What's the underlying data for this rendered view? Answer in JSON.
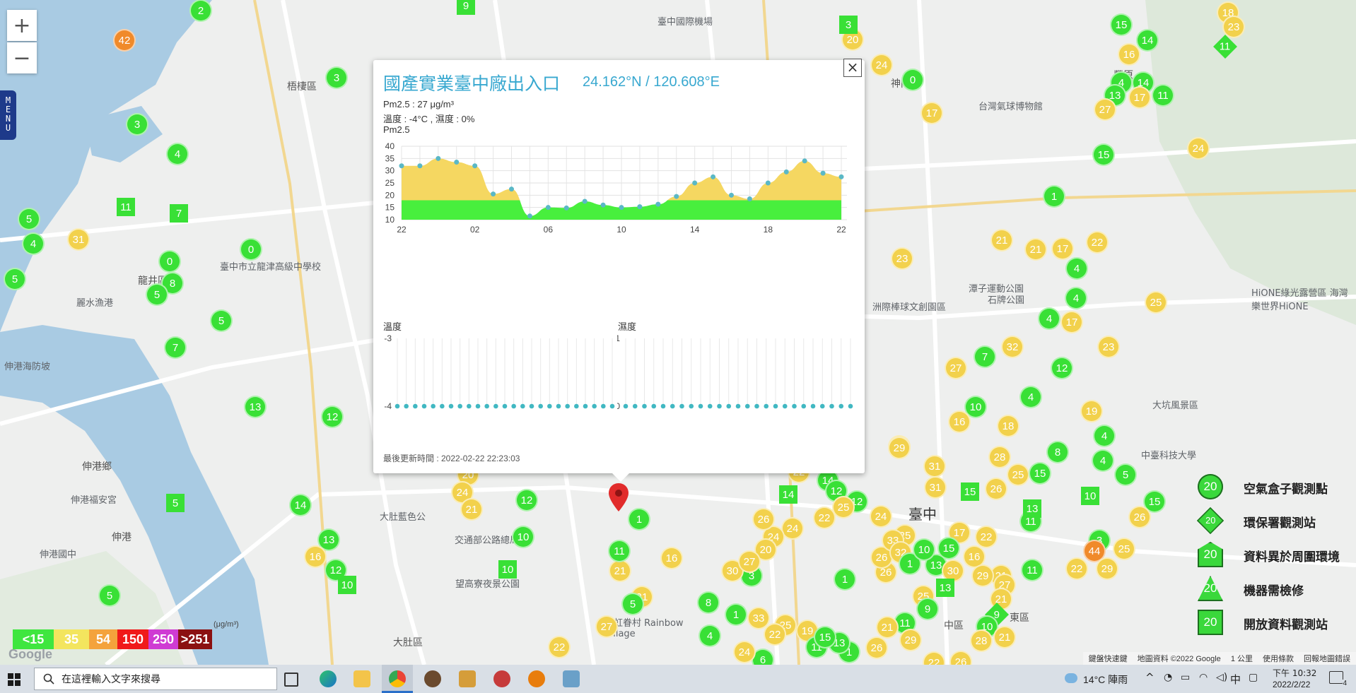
{
  "map": {
    "zoom_in": "+",
    "zoom_out": "−",
    "menu_label": "MENU",
    "place_labels": [
      {
        "text": "臺中國際機場",
        "cls": "road"
      },
      {
        "text": "梧棲區",
        "cls": "dist"
      },
      {
        "text": "龍井區",
        "cls": "dist"
      },
      {
        "text": "大肚區",
        "cls": "dist"
      },
      {
        "text": "臺中市立龍津高級中學校",
        "cls": "poi"
      },
      {
        "text": "麗水漁港",
        "cls": "poi"
      },
      {
        "text": "伸港海防坡",
        "cls": "poi"
      },
      {
        "text": "伸港鄉",
        "cls": "dist"
      },
      {
        "text": "伸港福安宮",
        "cls": "poi"
      },
      {
        "text": "伸港國中",
        "cls": "poi"
      },
      {
        "text": "伸港",
        "cls": "dist"
      },
      {
        "text": "大肚藍色公",
        "cls": "poi"
      },
      {
        "text": "交通部公路總局",
        "cls": "poi"
      },
      {
        "text": "望高寮夜景公園",
        "cls": "poi"
      },
      {
        "text": "彩虹眷村 Rainbow Village",
        "cls": "poi"
      },
      {
        "text": "台灣氣球博物館",
        "cls": "poi"
      },
      {
        "text": "神岡區",
        "cls": "dist"
      },
      {
        "text": "大坑風景區",
        "cls": "poi"
      },
      {
        "text": "中臺科技大學",
        "cls": "poi"
      },
      {
        "text": "洲際棒球文創園區",
        "cls": "poi"
      },
      {
        "text": "潭子運動公園",
        "cls": "poi"
      },
      {
        "text": "臺中",
        "cls": "city"
      },
      {
        "text": "中區",
        "cls": "dist"
      },
      {
        "text": "東區",
        "cls": "dist"
      },
      {
        "text": "HiONE綠光露營區 海灣樂世界HiONE",
        "cls": "poi"
      },
      {
        "text": "豐原",
        "cls": "dist"
      },
      {
        "text": "石牌公園",
        "cls": "poi"
      }
    ],
    "attribution": [
      "鍵盤快速鍵",
      "地圖資料 ©2022 Google",
      "1 公里",
      "使用條款",
      "回報地圖錯誤"
    ],
    "google_logo": "Google"
  },
  "markers": [
    {
      "t": "c",
      "v": "2",
      "c": "g"
    },
    {
      "t": "c",
      "v": "42",
      "c": "o"
    },
    {
      "t": "s",
      "v": "9",
      "c": "g"
    },
    {
      "t": "c",
      "v": "3",
      "c": "g"
    },
    {
      "t": "c",
      "v": "3",
      "c": "g"
    },
    {
      "t": "c",
      "v": "4",
      "c": "g"
    },
    {
      "t": "s",
      "v": "11",
      "c": "g"
    },
    {
      "t": "s",
      "v": "7",
      "c": "g"
    },
    {
      "t": "c",
      "v": "5",
      "c": "g"
    },
    {
      "t": "c",
      "v": "4",
      "c": "g"
    },
    {
      "t": "c",
      "v": "31",
      "c": "y"
    },
    {
      "t": "c",
      "v": "5",
      "c": "g"
    },
    {
      "t": "c",
      "v": "0",
      "c": "g"
    },
    {
      "t": "c",
      "v": "0",
      "c": "g"
    },
    {
      "t": "c",
      "v": "8",
      "c": "g"
    },
    {
      "t": "c",
      "v": "5",
      "c": "g"
    },
    {
      "t": "c",
      "v": "5",
      "c": "g"
    },
    {
      "t": "c",
      "v": "13",
      "c": "g"
    },
    {
      "t": "c",
      "v": "7",
      "c": "g"
    },
    {
      "t": "c",
      "v": "12",
      "c": "g"
    },
    {
      "t": "s",
      "v": "5",
      "c": "g"
    },
    {
      "t": "c",
      "v": "14",
      "c": "g"
    },
    {
      "t": "c",
      "v": "13",
      "c": "g"
    },
    {
      "t": "c",
      "v": "16",
      "c": "y"
    },
    {
      "t": "c",
      "v": "12",
      "c": "g"
    },
    {
      "t": "s",
      "v": "10",
      "c": "g"
    },
    {
      "t": "c",
      "v": "5",
      "c": "g"
    },
    {
      "t": "c",
      "v": "20",
      "c": "y"
    },
    {
      "t": "s",
      "v": "3",
      "c": "g"
    },
    {
      "t": "c",
      "v": "24",
      "c": "y"
    },
    {
      "t": "c",
      "v": "0",
      "c": "g"
    },
    {
      "t": "c",
      "v": "17",
      "c": "y"
    },
    {
      "t": "c",
      "v": "18",
      "c": "y"
    },
    {
      "t": "c",
      "v": "23",
      "c": "y"
    },
    {
      "t": "c",
      "v": "15",
      "c": "g"
    },
    {
      "t": "c",
      "v": "14",
      "c": "g"
    },
    {
      "t": "c",
      "v": "16",
      "c": "y"
    },
    {
      "t": "d",
      "v": "11",
      "c": "g"
    },
    {
      "t": "c",
      "v": "4",
      "c": "g"
    },
    {
      "t": "c",
      "v": "14",
      "c": "g"
    },
    {
      "t": "c",
      "v": "13",
      "c": "g"
    },
    {
      "t": "c",
      "v": "17",
      "c": "y"
    },
    {
      "t": "c",
      "v": "11",
      "c": "g"
    },
    {
      "t": "c",
      "v": "27",
      "c": "y"
    },
    {
      "t": "c",
      "v": "15",
      "c": "g"
    },
    {
      "t": "c",
      "v": "24",
      "c": "y"
    },
    {
      "t": "c",
      "v": "1",
      "c": "g"
    },
    {
      "t": "c",
      "v": "21",
      "c": "y"
    },
    {
      "t": "c",
      "v": "21",
      "c": "y"
    },
    {
      "t": "c",
      "v": "17",
      "c": "y"
    },
    {
      "t": "c",
      "v": "22",
      "c": "y"
    },
    {
      "t": "c",
      "v": "23",
      "c": "y"
    },
    {
      "t": "c",
      "v": "4",
      "c": "g"
    },
    {
      "t": "c",
      "v": "4",
      "c": "g"
    },
    {
      "t": "c",
      "v": "25",
      "c": "y"
    },
    {
      "t": "c",
      "v": "4",
      "c": "g"
    },
    {
      "t": "c",
      "v": "17",
      "c": "y"
    },
    {
      "t": "c",
      "v": "32",
      "c": "y"
    },
    {
      "t": "c",
      "v": "23",
      "c": "y"
    },
    {
      "t": "c",
      "v": "27",
      "c": "y"
    },
    {
      "t": "c",
      "v": "7",
      "c": "g"
    },
    {
      "t": "c",
      "v": "12",
      "c": "g"
    },
    {
      "t": "c",
      "v": "4",
      "c": "g"
    },
    {
      "t": "c",
      "v": "10",
      "c": "g"
    },
    {
      "t": "c",
      "v": "19",
      "c": "y"
    },
    {
      "t": "c",
      "v": "16",
      "c": "y"
    },
    {
      "t": "c",
      "v": "18",
      "c": "y"
    },
    {
      "t": "c",
      "v": "4",
      "c": "g"
    },
    {
      "t": "c",
      "v": "19",
      "c": "y"
    },
    {
      "t": "c",
      "v": "29",
      "c": "y"
    },
    {
      "t": "c",
      "v": "28",
      "c": "y"
    },
    {
      "t": "c",
      "v": "8",
      "c": "g"
    },
    {
      "t": "c",
      "v": "31",
      "c": "y"
    },
    {
      "t": "c",
      "v": "25",
      "c": "y"
    },
    {
      "t": "c",
      "v": "15",
      "c": "g"
    },
    {
      "t": "c",
      "v": "4",
      "c": "g"
    },
    {
      "t": "c",
      "v": "5",
      "c": "g"
    },
    {
      "t": "c",
      "v": "31",
      "c": "y"
    },
    {
      "t": "c",
      "v": "26",
      "c": "y"
    },
    {
      "t": "s",
      "v": "15",
      "c": "g"
    },
    {
      "t": "s",
      "v": "10",
      "c": "g"
    },
    {
      "t": "c",
      "v": "15",
      "c": "g"
    },
    {
      "t": "c",
      "v": "26",
      "c": "y"
    },
    {
      "t": "c",
      "v": "11",
      "c": "g"
    },
    {
      "t": "c",
      "v": "3",
      "c": "g"
    },
    {
      "t": "c",
      "v": "44",
      "c": "o"
    },
    {
      "t": "c",
      "v": "25",
      "c": "y"
    },
    {
      "t": "c",
      "v": "29",
      "c": "y"
    },
    {
      "t": "c",
      "v": "22",
      "c": "y"
    },
    {
      "t": "c",
      "v": "17",
      "c": "y"
    },
    {
      "t": "c",
      "v": "15",
      "c": "g"
    },
    {
      "t": "c",
      "v": "22",
      "c": "y"
    },
    {
      "t": "c",
      "v": "16",
      "c": "y"
    },
    {
      "t": "c",
      "v": "21",
      "c": "y"
    },
    {
      "t": "c",
      "v": "27",
      "c": "y"
    },
    {
      "t": "c",
      "v": "21",
      "c": "y"
    },
    {
      "t": "d",
      "v": "9",
      "c": "g"
    },
    {
      "t": "c",
      "v": "10",
      "c": "g"
    },
    {
      "t": "c",
      "v": "28",
      "c": "y"
    },
    {
      "t": "c",
      "v": "21",
      "c": "y"
    },
    {
      "t": "s",
      "v": "13",
      "c": "g"
    },
    {
      "t": "c",
      "v": "11",
      "c": "g"
    },
    {
      "t": "c",
      "v": "13",
      "c": "g"
    },
    {
      "t": "c",
      "v": "25",
      "c": "y"
    },
    {
      "t": "c",
      "v": "24",
      "c": "y"
    },
    {
      "t": "c",
      "v": "12",
      "c": "g"
    },
    {
      "t": "c",
      "v": "22",
      "c": "y"
    },
    {
      "t": "c",
      "v": "14",
      "c": "g"
    },
    {
      "t": "c",
      "v": "22",
      "c": "y"
    },
    {
      "t": "s",
      "v": "14",
      "c": "g"
    },
    {
      "t": "c",
      "v": "12",
      "c": "g"
    },
    {
      "t": "c",
      "v": "25",
      "c": "y"
    },
    {
      "t": "c",
      "v": "24",
      "c": "y"
    },
    {
      "t": "c",
      "v": "24",
      "c": "y"
    },
    {
      "t": "c",
      "v": "26",
      "c": "y"
    },
    {
      "t": "c",
      "v": "20",
      "c": "y"
    },
    {
      "t": "c",
      "v": "3",
      "c": "g"
    },
    {
      "t": "c",
      "v": "1",
      "c": "g"
    },
    {
      "t": "c",
      "v": "33",
      "c": "y"
    },
    {
      "t": "c",
      "v": "25",
      "c": "y"
    },
    {
      "t": "c",
      "v": "19",
      "c": "y"
    },
    {
      "t": "c",
      "v": "11",
      "c": "g"
    },
    {
      "t": "c",
      "v": "1",
      "c": "g"
    },
    {
      "t": "c",
      "v": "26",
      "c": "y"
    },
    {
      "t": "c",
      "v": "26",
      "c": "y"
    },
    {
      "t": "c",
      "v": "33",
      "c": "y"
    },
    {
      "t": "c",
      "v": "32",
      "c": "y"
    },
    {
      "t": "c",
      "v": "1",
      "c": "g"
    },
    {
      "t": "c",
      "v": "10",
      "c": "g"
    },
    {
      "t": "c",
      "v": "30",
      "c": "y"
    },
    {
      "t": "c",
      "v": "29",
      "c": "y"
    },
    {
      "t": "s",
      "v": "13",
      "c": "g"
    },
    {
      "t": "c",
      "v": "25",
      "c": "y"
    },
    {
      "t": "c",
      "v": "9",
      "c": "g"
    },
    {
      "t": "c",
      "v": "11",
      "c": "g"
    },
    {
      "t": "c",
      "v": "21",
      "c": "y"
    },
    {
      "t": "c",
      "v": "26",
      "c": "y"
    },
    {
      "t": "c",
      "v": "29",
      "c": "y"
    },
    {
      "t": "c",
      "v": "22",
      "c": "y"
    },
    {
      "t": "c",
      "v": "26",
      "c": "y"
    },
    {
      "t": "c",
      "v": "1",
      "c": "g"
    },
    {
      "t": "c",
      "v": "13",
      "c": "g"
    },
    {
      "t": "c",
      "v": "15",
      "c": "g"
    },
    {
      "t": "c",
      "v": "22",
      "c": "y"
    },
    {
      "t": "c",
      "v": "6",
      "c": "g"
    },
    {
      "t": "c",
      "v": "24",
      "c": "y"
    },
    {
      "t": "c",
      "v": "4",
      "c": "g"
    },
    {
      "t": "c",
      "v": "8",
      "c": "g"
    },
    {
      "t": "c",
      "v": "30",
      "c": "y"
    },
    {
      "t": "c",
      "v": "27",
      "c": "y"
    },
    {
      "t": "c",
      "v": "16",
      "c": "y"
    },
    {
      "t": "c",
      "v": "21",
      "c": "y"
    },
    {
      "t": "c",
      "v": "5",
      "c": "g"
    },
    {
      "t": "c",
      "v": "21",
      "c": "y"
    },
    {
      "t": "c",
      "v": "27",
      "c": "y"
    },
    {
      "t": "c",
      "v": "22",
      "c": "y"
    },
    {
      "t": "c",
      "v": "20",
      "c": "y"
    },
    {
      "t": "c",
      "v": "24",
      "c": "y"
    },
    {
      "t": "c",
      "v": "21",
      "c": "y"
    },
    {
      "t": "s",
      "v": "10",
      "c": "g"
    },
    {
      "t": "c",
      "v": "12",
      "c": "g"
    },
    {
      "t": "c",
      "v": "25",
      "c": "y"
    },
    {
      "t": "c",
      "v": "10",
      "c": "g"
    },
    {
      "t": "c",
      "v": "1",
      "c": "g"
    },
    {
      "t": "c",
      "v": "11",
      "c": "g"
    }
  ],
  "popup": {
    "title": "國產實業臺中廠出入口",
    "coord": "24.162°N / 120.608°E",
    "pm_line": "Pm2.5 : 27 μg/m³",
    "temp_line": "溫度 : -4°C , 濕度 : 0%",
    "pm_chart_label": "Pm2.5",
    "temp_chart_label": "溫度",
    "hum_chart_label": "濕度",
    "updated": "最後更新時間 : 2022-02-22 22:23:03",
    "close_label": "×"
  },
  "chart_data": [
    {
      "type": "area",
      "title": "Pm2.5",
      "x": [
        "22",
        "23",
        "00",
        "01",
        "02",
        "03",
        "04",
        "05",
        "06",
        "07",
        "08",
        "09",
        "10",
        "11",
        "12",
        "13",
        "14",
        "15",
        "16",
        "17",
        "18",
        "19",
        "20",
        "21",
        "22"
      ],
      "xticks": [
        "22",
        "02",
        "06",
        "10",
        "14",
        "18",
        "22"
      ],
      "values": [
        32,
        32,
        35,
        33.5,
        32,
        20.5,
        22.5,
        11.5,
        15,
        14.8,
        17.5,
        16,
        15,
        15.3,
        16.3,
        19.5,
        25,
        27.5,
        20,
        18.5,
        25,
        29.5,
        34,
        29,
        27.5
      ],
      "ylim": [
        10,
        40
      ],
      "yticks": [
        10,
        15,
        20,
        25,
        30,
        35,
        40
      ],
      "grid": true,
      "colors": {
        "line": "#5ab8c6",
        "above": "#f5d761",
        "below": "#48ef3d",
        "threshold": 18
      }
    },
    {
      "type": "line",
      "title": "溫度",
      "values": [
        -4,
        -4,
        -4,
        -4,
        -4,
        -4,
        -4,
        -4,
        -4,
        -4,
        -4,
        -4,
        -4,
        -4,
        -4,
        -4,
        -4,
        -4,
        -4,
        -4,
        -4,
        -4,
        -4,
        -4,
        -4
      ],
      "yticks": [
        -3,
        -4
      ],
      "ylim": [
        -4,
        -3
      ],
      "grid": true,
      "colors": {
        "point": "#41b8c2"
      }
    },
    {
      "type": "line",
      "title": "濕度",
      "values": [
        0,
        0,
        0,
        0,
        0,
        0,
        0,
        0,
        0,
        0,
        0,
        0,
        0,
        0,
        0,
        0,
        0,
        0,
        0,
        0,
        0,
        0,
        0,
        0,
        0
      ],
      "yticks": [
        1,
        0
      ],
      "ylim": [
        0,
        1
      ],
      "grid": true,
      "colors": {
        "point": "#41b8c2"
      }
    }
  ],
  "legend": {
    "unit": "(μg/m³)",
    "scale": [
      {
        "label": "<15",
        "color": "#3fe63f"
      },
      {
        "label": "35",
        "color": "#f3e55e"
      },
      {
        "label": "54",
        "color": "#f4a33c"
      },
      {
        "label": "150",
        "color": "#f01a1a"
      },
      {
        "label": "250",
        "color": "#cf3bd3"
      },
      {
        "label": ">251",
        "color": "#8b1111"
      }
    ],
    "types": [
      {
        "label": "空氣盒子觀測點",
        "shape": "circle",
        "value": "20"
      },
      {
        "label": "環保署觀測站",
        "shape": "diamond",
        "value": "20"
      },
      {
        "label": "資料異於周圍環境",
        "shape": "pentagon",
        "value": "20"
      },
      {
        "label": "機器需檢修",
        "shape": "triangle",
        "value": "20"
      },
      {
        "label": "開放資料觀測站",
        "shape": "square",
        "value": "20"
      }
    ]
  },
  "colors": {
    "g": "#39e036",
    "y": "#f2d14c",
    "o": "#f08a2a",
    "title": "#38a8d0"
  },
  "taskbar": {
    "search_placeholder": "在這裡輸入文字來搜尋",
    "weather": "14°C 陣雨",
    "ime": "中",
    "time": "下午 10:32",
    "date": "2022/2/22",
    "notification_count": "4"
  }
}
